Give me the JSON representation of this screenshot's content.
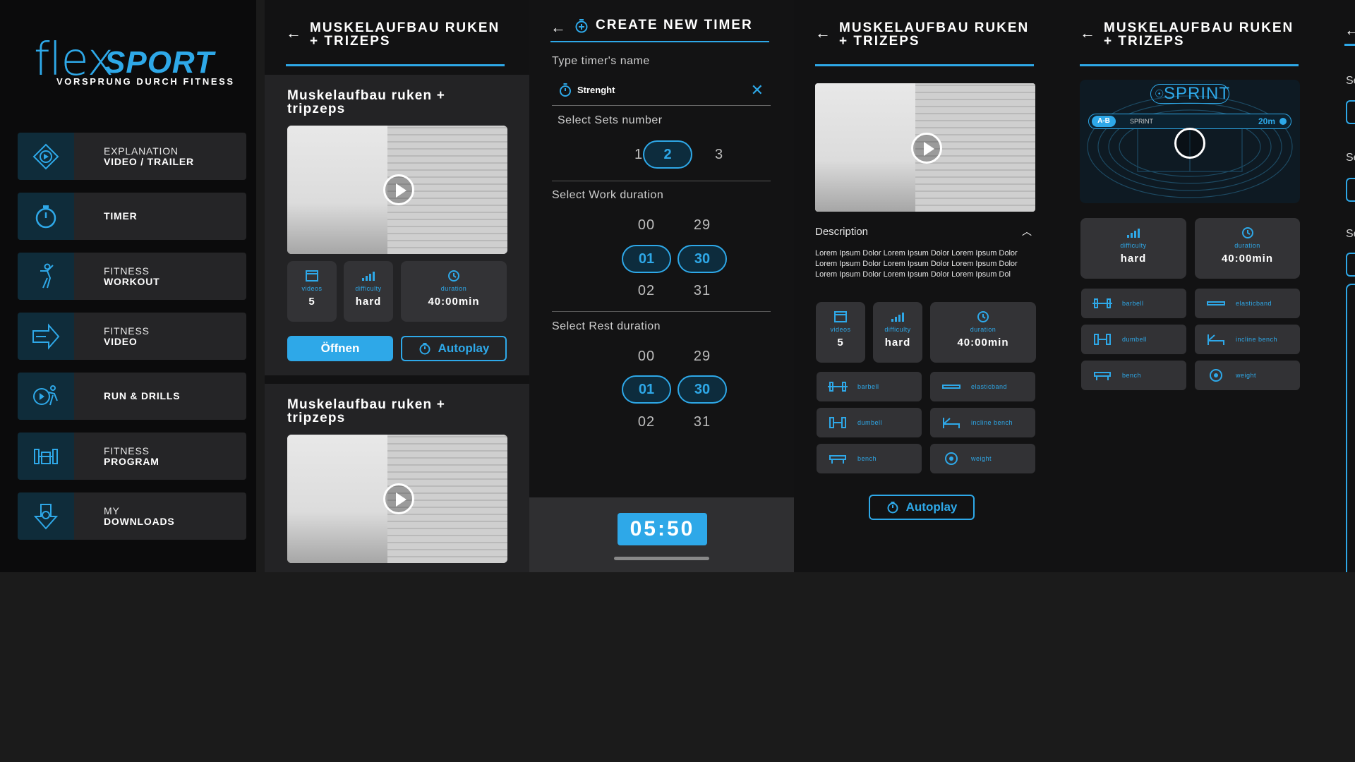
{
  "menu": {
    "logo_flex": "flex",
    "logo_sport": "SPORT",
    "logo_tagline": "VORSPRUNG DURCH FITNESS",
    "items": [
      {
        "line1": "EXPLANATION",
        "line2": "VIDEO / TRAILER",
        "icon": "compass-play-icon"
      },
      {
        "line1": "",
        "line2": "TIMER",
        "icon": "stopwatch-icon"
      },
      {
        "line1": "FITNESS",
        "line2": "WORKOUT",
        "icon": "workout-person-icon"
      },
      {
        "line1": "FITNESS",
        "line2": "VIDEO",
        "icon": "video-arrow-icon"
      },
      {
        "line1": "",
        "line2": "RUN & DRILLS",
        "icon": "runner-icon"
      },
      {
        "line1": "FITNESS",
        "line2": "PROGRAM",
        "icon": "program-dumbbell-icon"
      },
      {
        "line1": "MY",
        "line2": "DOWNLOADS",
        "icon": "download-arrow-icon"
      }
    ]
  },
  "screen2": {
    "title": "MUSKELAUFBAU RUKEN + TRIZEPS",
    "cards": [
      {
        "title": "Muskelaufbau ruken + tripzeps"
      },
      {
        "title": "Muskelaufbau ruken + tripzeps"
      }
    ],
    "stats": {
      "videos_label": "videos",
      "videos_value": "5",
      "difficulty_label": "difficulty",
      "difficulty_value": "hard",
      "duration_label": "duration",
      "duration_value": "40:00min"
    },
    "open_button": "Öffnen",
    "autoplay_button": "Autoplay"
  },
  "screen3": {
    "title": "CREATE NEW TIMER",
    "name_label": "Type timer's name",
    "name_value": "Strenght",
    "sets_label": "Select Sets number",
    "sets": [
      "1",
      "2",
      "3"
    ],
    "work_label": "Select Work duration",
    "work_min": [
      "00",
      "01",
      "02"
    ],
    "work_sec": [
      "29",
      "30",
      "31"
    ],
    "rest_label": "Select Rest duration",
    "rest_min": [
      "00",
      "01",
      "02"
    ],
    "rest_sec": [
      "29",
      "30",
      "31"
    ],
    "total": "05:50"
  },
  "screen4": {
    "title": "MUSKELAUFBAU RUKEN + TRIZEPS",
    "description_title": "Description",
    "description_body": "Lorem Ipsum Dolor Lorem Ipsum Dolor Lorem Ipsum Dolor Lorem Ipsum Dolor Lorem Ipsum Dolor Lorem Ipsum Dolor Lorem Ipsum Dolor Lorem Ipsum Dolor Lorem Ipsum Dol",
    "equipment": [
      "barbell",
      "elasticband",
      "dumbell",
      "incline bench",
      "bench",
      "weight"
    ],
    "autoplay_button": "Autoplay"
  },
  "screen5": {
    "title": "MUSKELAUFBAU RUKEN + TRIZEPS",
    "banner_title": "SPRINT",
    "banner_tag": "A-B",
    "banner_sub": "SPRINT",
    "banner_distance": "20m",
    "equipment": [
      "barbell",
      "elasticband",
      "dumbell",
      "incline bench",
      "bench",
      "weight"
    ]
  },
  "screen6": {
    "labels": [
      "Se",
      "Se",
      "Se"
    ]
  },
  "colors": {
    "accent": "#2ea8e8",
    "background": "#121213",
    "card": "#232325"
  }
}
